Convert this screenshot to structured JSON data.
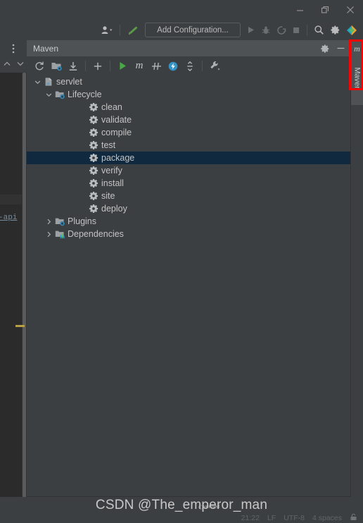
{
  "window": {
    "controls": [
      {
        "name": "minimize-button",
        "glyph": "—"
      },
      {
        "name": "restore-button",
        "glyph": "❐"
      },
      {
        "name": "close-button",
        "glyph": "✕"
      }
    ]
  },
  "toolbar": {
    "profile_icon": "user-profile-icon",
    "build_icon": "build-hammer-icon",
    "run_config_label": "Add Configuration...",
    "run_icon": "run-play-icon",
    "debug_icon": "debug-bug-icon",
    "run_coverage_icon": "run-with-coverage-icon",
    "stop_icon": "stop-square-icon",
    "search_icon": "search-magnifier-icon",
    "settings_icon": "settings-gear-icon",
    "ide_logo_icon": "intellij-idea-logo-icon"
  },
  "left_strip": {
    "more_icon": "more-vertical-icon",
    "collapse_icon": "chevron-up-icon",
    "expand_icon": "chevron-down-icon",
    "editor_fragment": "-api"
  },
  "maven_panel": {
    "title": "Maven",
    "header_actions": [
      {
        "name": "maven-settings-gear-icon",
        "glyph": "⚙"
      },
      {
        "name": "hide-panel-icon",
        "glyph": "—"
      }
    ],
    "toolbar_buttons": [
      {
        "name": "reload-all-maven-projects-button",
        "icon": "refresh-icon"
      },
      {
        "name": "generate-sources-button",
        "icon": "folder-refresh-icon"
      },
      {
        "name": "download-sources-button",
        "icon": "download-icon"
      },
      {
        "name": "add-maven-project-button",
        "icon": "plus-icon"
      },
      {
        "name": "run-maven-build-button",
        "icon": "run-play-icon"
      },
      {
        "name": "execute-maven-goal-button",
        "icon": "m-goal-icon"
      },
      {
        "name": "toggle-skip-tests-button",
        "icon": "skip-tests-icon"
      },
      {
        "name": "toggle-offline-mode-button",
        "icon": "offline-mode-icon"
      },
      {
        "name": "collapse-all-button",
        "icon": "collapse-all-icon"
      },
      {
        "name": "maven-settings-button",
        "icon": "wrench-icon"
      }
    ]
  },
  "tree": {
    "nodes": [
      {
        "label": "servlet",
        "level": 0,
        "twisty": "expanded",
        "icon": "maven-project-icon",
        "selected": false
      },
      {
        "label": "Lifecycle",
        "level": 1,
        "twisty": "expanded",
        "icon": "lifecycle-folder-icon",
        "selected": false
      },
      {
        "label": "clean",
        "level": 2,
        "twisty": "none",
        "icon": "maven-goal-gear-icon",
        "selected": false
      },
      {
        "label": "validate",
        "level": 2,
        "twisty": "none",
        "icon": "maven-goal-gear-icon",
        "selected": false
      },
      {
        "label": "compile",
        "level": 2,
        "twisty": "none",
        "icon": "maven-goal-gear-icon",
        "selected": false
      },
      {
        "label": "test",
        "level": 2,
        "twisty": "none",
        "icon": "maven-goal-gear-icon",
        "selected": false
      },
      {
        "label": "package",
        "level": 2,
        "twisty": "none",
        "icon": "maven-goal-gear-icon",
        "selected": true
      },
      {
        "label": "verify",
        "level": 2,
        "twisty": "none",
        "icon": "maven-goal-gear-icon",
        "selected": false
      },
      {
        "label": "install",
        "level": 2,
        "twisty": "none",
        "icon": "maven-goal-gear-icon",
        "selected": false
      },
      {
        "label": "site",
        "level": 2,
        "twisty": "none",
        "icon": "maven-goal-gear-icon",
        "selected": false
      },
      {
        "label": "deploy",
        "level": 2,
        "twisty": "none",
        "icon": "maven-goal-gear-icon",
        "selected": false
      },
      {
        "label": "Plugins",
        "level": 1,
        "twisty": "collapsed",
        "icon": "plugins-folder-icon",
        "selected": false
      },
      {
        "label": "Dependencies",
        "level": 1,
        "twisty": "collapsed",
        "icon": "dependencies-icon",
        "selected": false
      }
    ]
  },
  "right_tab_strip": {
    "tab_icon": "m-maven-icon",
    "tab_label": "Maven"
  },
  "annotation": {
    "color": "#ff0000"
  },
  "watermark": {
    "text": "CSDN @The_emperor_man",
    "logo_text": "verified"
  },
  "status_bar": {
    "time": "21:22",
    "line_separator": "LF",
    "encoding": "UTF-8",
    "indent": "4 spaces",
    "lock_icon": "read-only-lock-icon"
  }
}
